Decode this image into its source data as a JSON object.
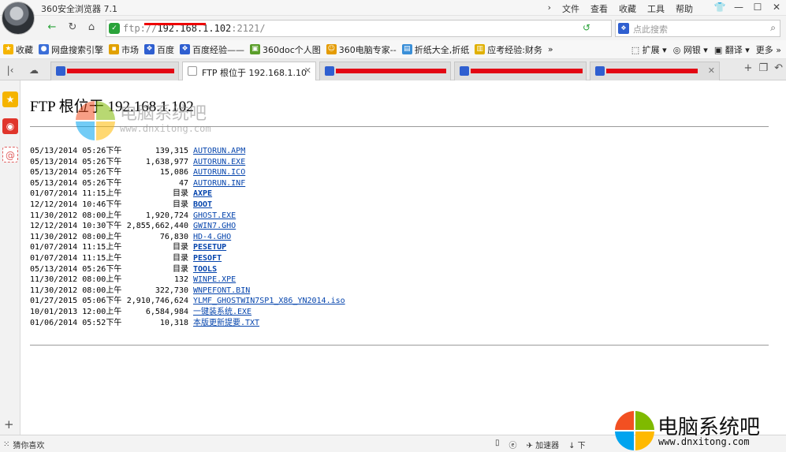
{
  "app_title": "360安全浏览器 7.1",
  "menus": [
    "文件",
    "查看",
    "收藏",
    "工具",
    "帮助"
  ],
  "window_controls": [
    "▾",
    "—",
    "☐",
    "✕"
  ],
  "address": {
    "scheme": "ftp://",
    "host": "192.168.1.102",
    "port": ":2121/"
  },
  "search": {
    "placeholder": "点此搜索"
  },
  "bookmarks": [
    {
      "label": "收藏",
      "color": "#f5b400"
    },
    {
      "label": "网盘搜索引擎",
      "color": "#3c6fd8"
    },
    {
      "label": "市场",
      "color": "#e1a100"
    },
    {
      "label": "百度",
      "color": "#2f5fd0"
    },
    {
      "label": "百度经验——",
      "color": "#2f5fd0"
    },
    {
      "label": "360doc个人图",
      "color": "#5a9e2a"
    },
    {
      "label": "360电脑专家--",
      "color": "#e49b00"
    },
    {
      "label": "折纸大全,折纸",
      "color": "#3a8fd8"
    },
    {
      "label": "应考经验:财务",
      "color": "#e0b000"
    }
  ],
  "bookmarks_right": [
    "扩展",
    "网银",
    "翻译",
    "更多"
  ],
  "tabs": {
    "active_label": "FTP 根位于 192.168.1.10"
  },
  "page": {
    "heading": "FTP 根位于 192.168.1.102",
    "dir_label": "目录",
    "entries": [
      {
        "date": "05/13/2014 05:26下午",
        "size": "139,315",
        "name": "AUTORUN.APM",
        "dir": false
      },
      {
        "date": "05/13/2014 05:26下午",
        "size": "1,638,977",
        "name": "AUTORUN.EXE",
        "dir": false
      },
      {
        "date": "05/13/2014 05:26下午",
        "size": "15,086",
        "name": "AUTORUN.ICO",
        "dir": false
      },
      {
        "date": "05/13/2014 05:26下午",
        "size": "47",
        "name": "AUTORUN.INF",
        "dir": false
      },
      {
        "date": "01/07/2014 11:15上午",
        "size": "",
        "name": "AXPE",
        "dir": true
      },
      {
        "date": "12/12/2014 10:46下午",
        "size": "",
        "name": "BOOT",
        "dir": true
      },
      {
        "date": "11/30/2012 08:00上午",
        "size": "1,920,724",
        "name": "GHOST.EXE",
        "dir": false
      },
      {
        "date": "12/12/2014 10:30下午",
        "size": "2,855,662,440",
        "name": "GWIN7.GHO",
        "dir": false
      },
      {
        "date": "11/30/2012 08:00上午",
        "size": "76,830",
        "name": "HD-4.GHO",
        "dir": false
      },
      {
        "date": "01/07/2014 11:15上午",
        "size": "",
        "name": "PESETUP",
        "dir": true
      },
      {
        "date": "01/07/2014 11:15上午",
        "size": "",
        "name": "PESOFT",
        "dir": true
      },
      {
        "date": "05/13/2014 05:26下午",
        "size": "",
        "name": "TOOLS",
        "dir": true
      },
      {
        "date": "11/30/2012 08:00上午",
        "size": "132",
        "name": "WINPE.XPE",
        "dir": false
      },
      {
        "date": "11/30/2012 08:00上午",
        "size": "322,730",
        "name": "WNPEFONT.BIN",
        "dir": false
      },
      {
        "date": "01/27/2015 05:06下午",
        "size": "2,910,746,624",
        "name": "YLMF_GHOSTWIN7SP1_X86_YN2014.iso",
        "dir": false
      },
      {
        "date": "10/01/2013 12:00上午",
        "size": "6,584,984",
        "name": "一键装系统.EXE",
        "dir": false
      },
      {
        "date": "01/06/2014 05:52下午",
        "size": "10,318",
        "name": "本版更新提要.TXT",
        "dir": false
      }
    ]
  },
  "watermark": {
    "name": "电脑系统吧",
    "url": "www.dnxitong.com"
  },
  "status": {
    "left": "猜你喜欢",
    "right": [
      "加速器",
      "下"
    ]
  },
  "colors": {
    "link": "#0645ad",
    "redaction": "#e30613",
    "secure_green": "#2aa33a"
  }
}
